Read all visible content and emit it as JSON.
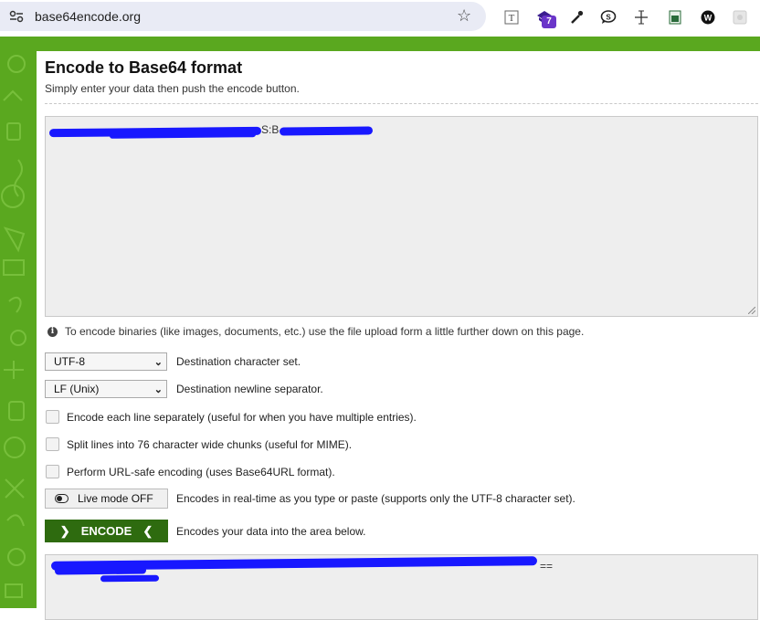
{
  "browser": {
    "url": "base64encode.org",
    "extensions": [
      "text-icon",
      "extension-badge-icon",
      "eyedropper-icon",
      "speech-icon",
      "crosshair-icon",
      "sheet-icon",
      "w-circle-icon",
      "puzzle-icon"
    ],
    "badge_count": "7"
  },
  "page": {
    "title": "Encode to Base64 format",
    "subtitle": "Simply enter your data then push the encode button.",
    "input_visible_text": "S:B",
    "info_text": "To encode binaries (like images, documents, etc.) use the file upload form a little further down on this page.",
    "charset": {
      "value": "UTF-8",
      "label": "Destination character set."
    },
    "newline": {
      "value": "LF (Unix)",
      "label": "Destination newline separator."
    },
    "options": [
      {
        "label": "Encode each line separately (useful for when you have multiple entries).",
        "checked": false
      },
      {
        "label": "Split lines into 76 character wide chunks (useful for MIME).",
        "checked": false
      },
      {
        "label": "Perform URL-safe encoding (uses Base64URL format).",
        "checked": false
      }
    ],
    "live_mode": {
      "button": "Live mode OFF",
      "label": "Encodes in real-time as you type or paste (supports only the UTF-8 character set)."
    },
    "encode": {
      "button": "ENCODE",
      "label": "Encodes your data into the area below."
    },
    "output_visible_text": "=="
  },
  "colors": {
    "brand_green": "#5aa81f",
    "button_green": "#2e6b0f",
    "redaction": "#1818ff"
  }
}
